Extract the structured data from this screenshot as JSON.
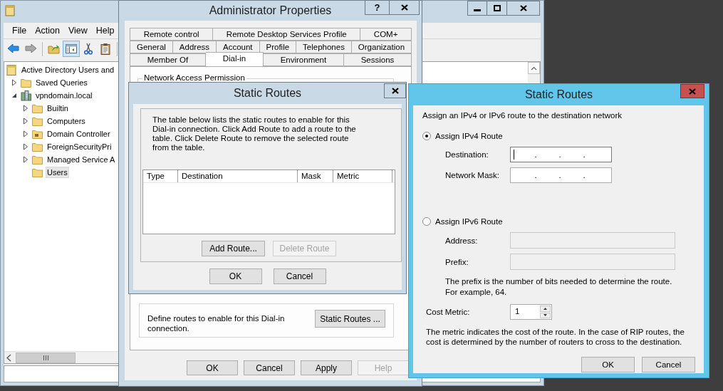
{
  "main_window": {
    "menu": [
      "File",
      "Action",
      "View",
      "Help"
    ],
    "toolbar": [
      [
        {
          "kind": "back",
          "pressed": false
        },
        {
          "kind": "forward",
          "pressed": false
        }
      ],
      [
        {
          "kind": "folder-up",
          "pressed": false
        },
        {
          "kind": "console-tree",
          "pressed": true
        },
        {
          "kind": "cut",
          "pressed": false
        },
        {
          "kind": "paste",
          "pressed": false
        }
      ]
    ],
    "tree": [
      {
        "label": "Active Directory Users and",
        "kind": "root",
        "selected": false,
        "children": [
          {
            "label": "Saved Queries",
            "kind": "folder",
            "expanded": false,
            "selected": false
          },
          {
            "label": "vpndomain.local",
            "kind": "domain",
            "expanded": true,
            "selected": false,
            "children": [
              {
                "label": "Builtin",
                "kind": "folder",
                "expanded": false,
                "selected": false
              },
              {
                "label": "Computers",
                "kind": "folder",
                "expanded": false,
                "selected": false
              },
              {
                "label": "Domain Controller",
                "kind": "ou",
                "expanded": false,
                "selected": false
              },
              {
                "label": "ForeignSecurityPri",
                "kind": "folder",
                "expanded": false,
                "selected": false
              },
              {
                "label": "Managed Service A",
                "kind": "folder",
                "expanded": false,
                "selected": false
              },
              {
                "label": "Users",
                "kind": "folder",
                "selected": true
              }
            ]
          }
        ]
      }
    ]
  },
  "properties_dialog": {
    "title": "Administrator Properties",
    "help_button": "?",
    "tab_rows": [
      [
        {
          "label": "Remote control",
          "selected": false
        },
        {
          "label": "Remote Desktop Services Profile",
          "selected": false
        },
        {
          "label": "COM+",
          "selected": false
        }
      ],
      [
        {
          "label": "General",
          "selected": false
        },
        {
          "label": "Address",
          "selected": false
        },
        {
          "label": "Account",
          "selected": false
        },
        {
          "label": "Profile",
          "selected": false
        },
        {
          "label": "Telephones",
          "selected": false
        },
        {
          "label": "Organization",
          "selected": false
        }
      ],
      [
        {
          "label": "Member Of",
          "selected": false
        },
        {
          "label": "Dial-in",
          "selected": true
        },
        {
          "label": "Environment",
          "selected": false
        },
        {
          "label": "Sessions",
          "selected": false
        }
      ]
    ],
    "permission_group": "Network Access Permission",
    "routes_text": "Define routes to enable for this Dial-in connection.",
    "routes_button": "Static Routes ...",
    "buttons": [
      {
        "label": "OK",
        "disabled": false
      },
      {
        "label": "Cancel",
        "disabled": false
      },
      {
        "label": "Apply",
        "disabled": false
      },
      {
        "label": "Help",
        "disabled": true
      }
    ]
  },
  "static_routes_dialog": {
    "title": "Static Routes",
    "description": "The table below lists the static routes to enable for this Dial-in connection. Click Add Route to add a route to the table. Click Delete Route to remove the selected route from the table.",
    "columns": [
      "Type",
      "Destination",
      "Mask",
      "Metric"
    ],
    "route_buttons": [
      {
        "label": "Add Route...",
        "disabled": false
      },
      {
        "label": "Delete Route",
        "disabled": true
      }
    ],
    "buttons": [
      {
        "label": "OK",
        "disabled": false
      },
      {
        "label": "Cancel",
        "disabled": false
      }
    ]
  },
  "route_dialog": {
    "title": "Static Routes",
    "intro": "Assign an IPv4 or IPv6 route to the destination network",
    "options": [
      {
        "label": "Assign IPv4 Route",
        "selected": true,
        "fields": [
          {
            "label": "Destination:",
            "kind": "ip",
            "separator": ".",
            "focused": true,
            "disabled": false
          },
          {
            "label": "Network Mask:",
            "kind": "ip",
            "separator": ".",
            "focused": false,
            "disabled": false
          }
        ]
      },
      {
        "label": "Assign IPv6 Route",
        "selected": false,
        "fields": [
          {
            "label": "Address:",
            "kind": "text",
            "disabled": true
          },
          {
            "label": "Prefix:",
            "kind": "text",
            "disabled": true
          }
        ],
        "note": "The prefix is the number of bits needed to determine the route.\nFor example, 64."
      }
    ],
    "cost_label": "Cost Metric:",
    "cost_value": "1",
    "cost_note": "The metric indicates the cost of the route. In the case of RIP routes, the cost is determined by the number of routers to cross to the destination.",
    "buttons": [
      {
        "label": "OK",
        "disabled": false
      },
      {
        "label": "Cancel",
        "disabled": false
      }
    ]
  }
}
